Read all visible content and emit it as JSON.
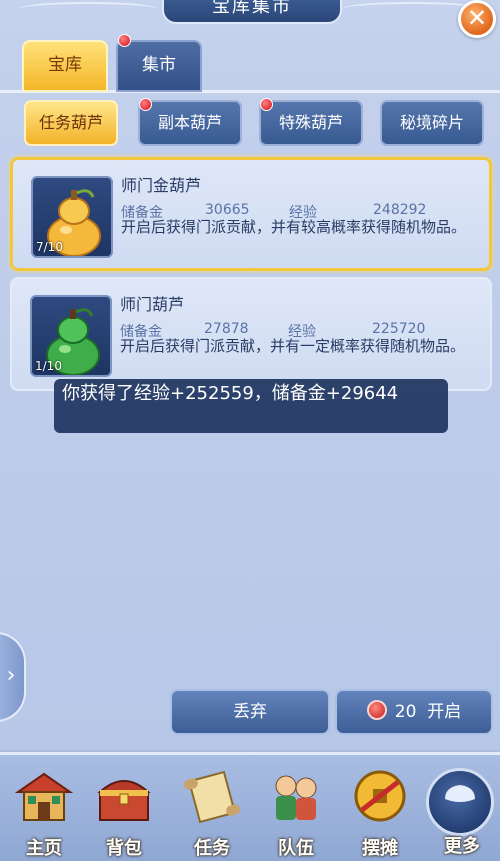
{
  "window": {
    "title": "宝库集市",
    "close_label": "✕"
  },
  "tabs": [
    {
      "label": "宝库",
      "active": true
    },
    {
      "label": "集市",
      "active": false,
      "has_notification": true
    }
  ],
  "sub_tabs": [
    {
      "label": "任务葫芦",
      "active": true,
      "has_notification": false
    },
    {
      "label": "副本葫芦",
      "active": false,
      "has_notification": true
    },
    {
      "label": "特殊葫芦",
      "active": false,
      "has_notification": true
    },
    {
      "label": "秘境碎片",
      "active": false,
      "has_notification": false
    }
  ],
  "items": [
    {
      "name": "师门金葫芦",
      "count": "7/10",
      "reserve_label": "储备金",
      "reserve_value": "30665",
      "exp_label": "经验",
      "exp_value": "248292",
      "description": "开启后获得门派贡献，并有较高概率获得随机物品。",
      "selected": true,
      "icon": "gold-gourd-icon"
    },
    {
      "name": "师门葫芦",
      "count": "1/10",
      "reserve_label": "储备金",
      "reserve_value": "27878",
      "exp_label": "经验",
      "exp_value": "225720",
      "description": "开启后获得门派贡献，并有一定概率获得随机物品。",
      "selected": false,
      "icon": "green-gourd-icon"
    }
  ],
  "toast": {
    "text": "你获得了经验+252559，储备金+29644"
  },
  "actions": {
    "discard_label": "丢弃",
    "open_cost": "20",
    "open_label": "开启"
  },
  "bottom_nav": [
    {
      "label": "主页",
      "icon": "home-icon"
    },
    {
      "label": "背包",
      "icon": "chest-icon"
    },
    {
      "label": "任务",
      "icon": "scroll-icon"
    },
    {
      "label": "队伍",
      "icon": "team-icon"
    },
    {
      "label": "摆摊",
      "icon": "coin-icon"
    },
    {
      "label": "更多",
      "icon": "more-icon"
    }
  ],
  "colors": {
    "accent_gold": "#f4b628",
    "panel_blue": "#3c5d96",
    "notification_red": "#d6101a"
  }
}
